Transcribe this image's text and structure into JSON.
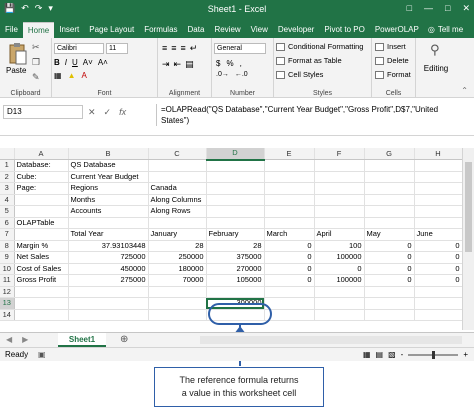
{
  "window": {
    "title": "Sheet1  -  Excel"
  },
  "tabs": [
    {
      "label": "File"
    },
    {
      "label": "Home"
    },
    {
      "label": "Insert"
    },
    {
      "label": "Page Layout"
    },
    {
      "label": "Formulas"
    },
    {
      "label": "Data"
    },
    {
      "label": "Review"
    },
    {
      "label": "View"
    },
    {
      "label": "Developer"
    },
    {
      "label": "Pivot to PO"
    },
    {
      "label": "PowerOLAP"
    }
  ],
  "tell_me": "Tell me",
  "ribbon": {
    "clipboard": {
      "paste": "Paste",
      "label": "Clipboard"
    },
    "font": {
      "name": "Calibri",
      "size": "11",
      "bold": "B",
      "italic": "I",
      "underline": "U",
      "label": "Font"
    },
    "alignment": {
      "label": "Alignment"
    },
    "number": {
      "format": "General",
      "currency": "$",
      "percent": "%",
      "label": "Number"
    },
    "styles": {
      "conditional": "Conditional Formatting",
      "table": "Format as Table",
      "cell": "Cell Styles",
      "label": "Styles"
    },
    "cells": {
      "insert": "Insert",
      "delete": "Delete",
      "format": "Format",
      "label": "Cells"
    },
    "editing": {
      "label": "Editing"
    }
  },
  "formula_bar": {
    "name_box": "D13",
    "formula": "=OLAPRead(\"QS Database\",\"Current Year Budget\",\"Gross Profit\",D$7,\"United States\")"
  },
  "grid": {
    "columns": [
      "A",
      "B",
      "C",
      "D",
      "E",
      "F",
      "G",
      "H"
    ],
    "rows": [
      {
        "n": "1",
        "cells": [
          "Database:",
          "QS Database",
          "",
          "",
          "",
          "",
          "",
          ""
        ]
      },
      {
        "n": "2",
        "cells": [
          "Cube:",
          "Current Year Budget",
          "",
          "",
          "",
          "",
          "",
          ""
        ]
      },
      {
        "n": "3",
        "cells": [
          "Page:",
          "Regions",
          "Canada",
          "",
          "",
          "",
          "",
          ""
        ]
      },
      {
        "n": "4",
        "cells": [
          "",
          "Months",
          "Along Columns",
          "",
          "",
          "",
          "",
          ""
        ]
      },
      {
        "n": "5",
        "cells": [
          "",
          "Accounts",
          "Along Rows",
          "",
          "",
          "",
          "",
          ""
        ]
      },
      {
        "n": "6",
        "cells": [
          "OLAPTable",
          "",
          "",
          "",
          "",
          "",
          "",
          ""
        ]
      },
      {
        "n": "7",
        "cells": [
          "",
          "Total Year",
          "January",
          "February",
          "March",
          "April",
          "May",
          "June"
        ]
      },
      {
        "n": "8",
        "cells": [
          "Margin %",
          "37.93103448",
          "28",
          "28",
          "0",
          "100",
          "0",
          "0"
        ]
      },
      {
        "n": "9",
        "cells": [
          "Net Sales",
          "725000",
          "250000",
          "375000",
          "0",
          "100000",
          "0",
          "0"
        ]
      },
      {
        "n": "10",
        "cells": [
          "Cost of Sales",
          "450000",
          "180000",
          "270000",
          "0",
          "0",
          "0",
          "0"
        ]
      },
      {
        "n": "11",
        "cells": [
          "Gross Profit",
          "275000",
          "70000",
          "105000",
          "0",
          "100000",
          "0",
          "0"
        ]
      },
      {
        "n": "12",
        "cells": [
          "",
          "",
          "",
          "",
          "",
          "",
          "",
          ""
        ]
      },
      {
        "n": "13",
        "cells": [
          "",
          "",
          "",
          "300000",
          "",
          "",
          "",
          ""
        ]
      },
      {
        "n": "14",
        "cells": [
          "",
          "",
          "",
          "",
          "",
          "",
          "",
          ""
        ]
      }
    ]
  },
  "sheet_tab": "Sheet1",
  "status": {
    "ready": "Ready",
    "zoom_minus": "-",
    "zoom_plus": "+"
  },
  "annotation": {
    "line1": "The reference formula returns",
    "line2": "a value in this worksheet cell"
  },
  "colors": {
    "excel_green": "#217346",
    "callout_blue": "#2f5fa8"
  }
}
